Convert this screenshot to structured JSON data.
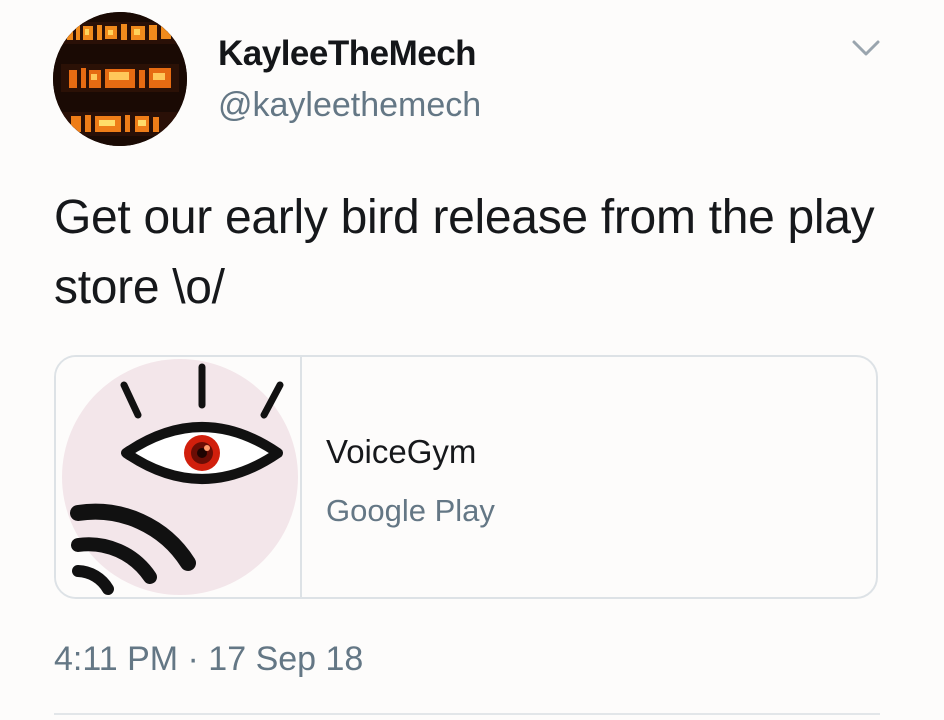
{
  "author": {
    "display_name": "KayleeTheMech",
    "handle": "@kayleethemech"
  },
  "tweet": {
    "text": "Get our early bird release from the play store \\o/",
    "timestamp": "4:11 PM · 17 Sep 18"
  },
  "card": {
    "title": "VoiceGym",
    "source": "Google Play",
    "image_icon": "voicegym-eye-signal-logo"
  },
  "icons": {
    "menu": "chevron-down-icon"
  },
  "colors": {
    "secondary_text": "#647785",
    "card_border": "#dde2e6",
    "logo_circle": "#f3e6ea",
    "logo_iris": "#d11f0c"
  }
}
